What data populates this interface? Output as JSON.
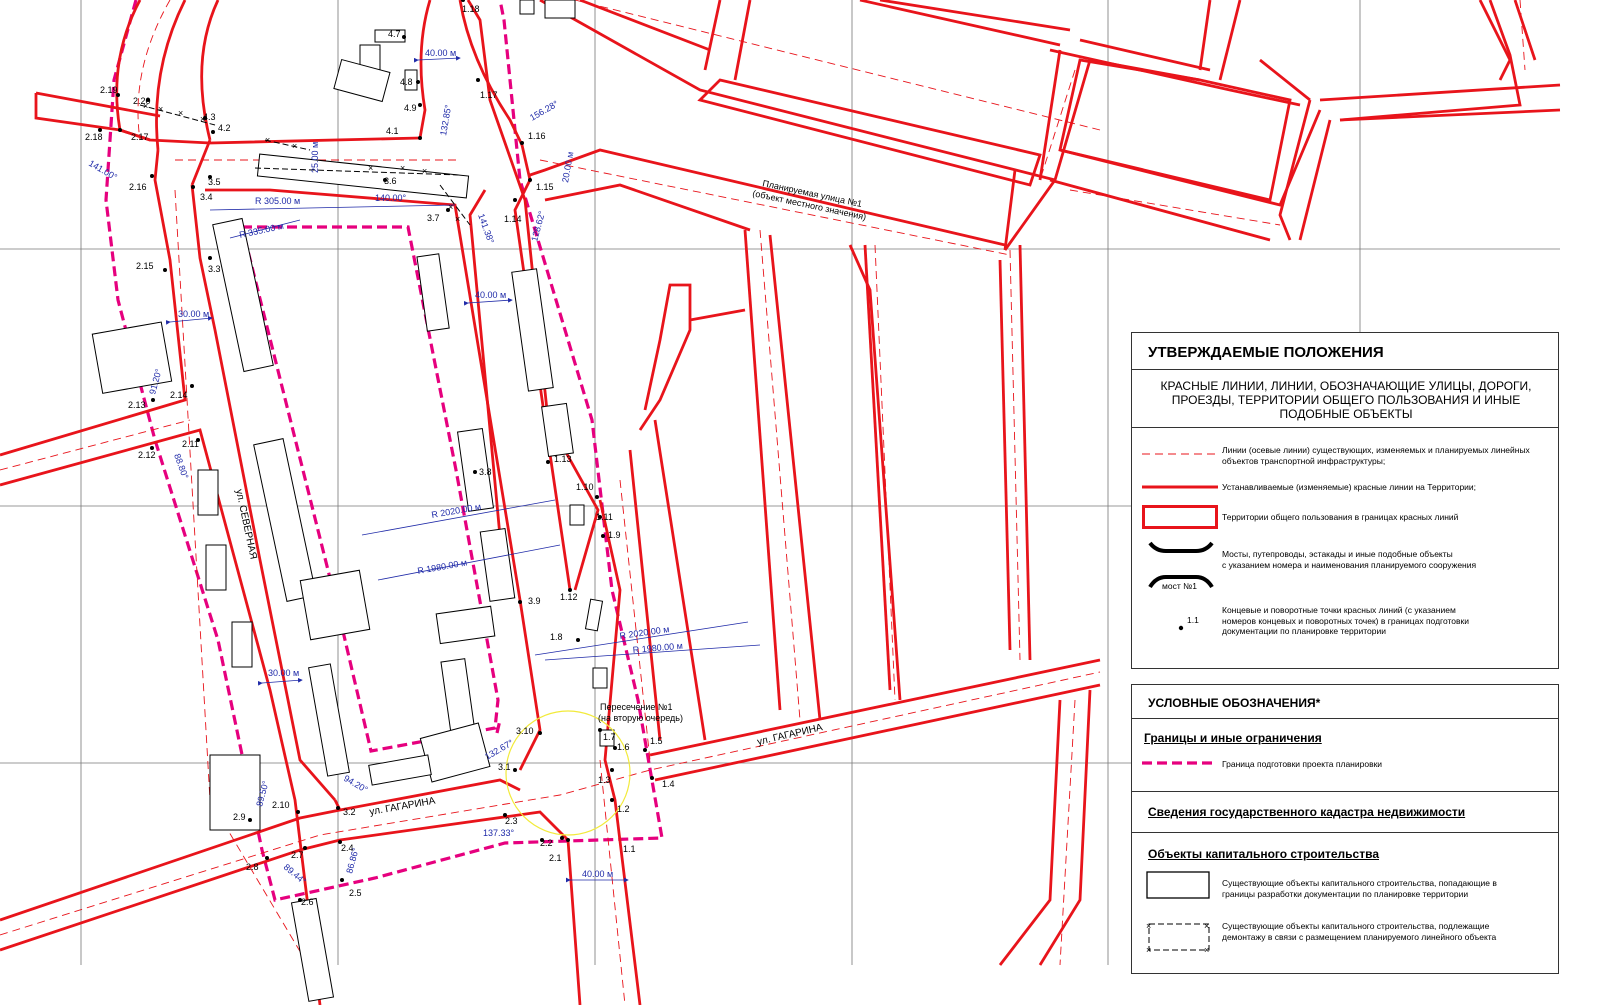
{
  "streets": {
    "severnaya": "ул. СЕВЕРНАЯ",
    "gagarina_left": "ул. ГАГАРИНА",
    "gagarina_right": "ул. ГАГАРИНА",
    "planned_1": "Планируемая улица №1",
    "planned_1_sub": "(объект местного значения)"
  },
  "intersection": {
    "label": "Пересечение №1",
    "sub": "(на вторую очередь)"
  },
  "dimensions": {
    "w40_top": "40.00 м",
    "w40_mid": "40.00 м",
    "w40_bottom": "40.00 м",
    "w30_left": "30.00 м",
    "w30_low": "30.00 м",
    "w25": "25.00 м",
    "w20": "20.00 м",
    "r305": "R 305.00 м",
    "r335": "R 335.00 м",
    "r2020_a": "R 2020.00 м",
    "r1980_a": "R 1980.00 м",
    "r2020_b": "R 2020.00 м",
    "r1980_b": "R 1980.00 м",
    "a141_00": "141.00°",
    "a132_85": "132.85°",
    "a156_28": "156.28°",
    "a140_00": "140.00°",
    "a141_38": "141.38°",
    "a128_62": "128.62°",
    "a91_20": "91.20°",
    "a88_80": "88.80°",
    "a89_50": "89.50°",
    "a94_20": "94.20°",
    "a132_67": "132.67°",
    "a137_33": "137.33°",
    "a89_44": "89.44°",
    "a86_86": "86.86°"
  },
  "points": {
    "p1_1": "1.1",
    "p1_2": "1.2",
    "p1_3": "1.3",
    "p1_4": "1.4",
    "p1_5": "1.5",
    "p1_6": "1.6",
    "p1_7": "1.7",
    "p1_8": "1.8",
    "p1_9": "1.9",
    "p1_10": "1.10",
    "p1_11": "1.11",
    "p1_12": "1.12",
    "p1_13": "1.13",
    "p1_14": "1.14",
    "p1_15": "1.15",
    "p1_16": "1.16",
    "p1_17": "1.17",
    "p1_18": "1.18",
    "p2_1": "2.1",
    "p2_2": "2.2",
    "p2_3": "2.3",
    "p2_4": "2.4",
    "p2_5": "2.5",
    "p2_6": "2.6",
    "p2_7": "2.7",
    "p2_8": "2.8",
    "p2_9": "2.9",
    "p2_10": "2.10",
    "p2_11": "2.11",
    "p2_12": "2.12",
    "p2_13": "2.13",
    "p2_14": "2.14",
    "p2_15": "2.15",
    "p2_16": "2.16",
    "p2_17": "2.17",
    "p2_18": "2.18",
    "p2_19": "2.19",
    "p2_20": "2.20",
    "p3_1": "3.1",
    "p3_2": "3.2",
    "p3_3": "3.3",
    "p3_4": "3.4",
    "p3_5": "3.5",
    "p3_6": "3.6",
    "p3_7": "3.7",
    "p3_8": "3.8",
    "p3_9": "3.9",
    "p3_10": "3.10",
    "p4_1": "4.1",
    "p4_2": "4.2",
    "p4_3": "4.3",
    "p4_7": "4.7",
    "p4_8": "4.8",
    "p4_9": "4.9"
  },
  "legend_main": {
    "title": "УТВЕРЖДАЕМЫЕ ПОЛОЖЕНИЯ",
    "subtitle_l1": "КРАСНЫЕ ЛИНИИ, ЛИНИИ, ОБОЗНАЧАЮЩИЕ УЛИЦЫ, ДОРОГИ,",
    "subtitle_l2": "ПРОЕЗДЫ, ТЕРРИТОРИИ ОБЩЕГО ПОЛЬЗОВАНИЯ И ИНЫЕ",
    "subtitle_l3": "ПОДОБНЫЕ ОБЪЕКТЫ",
    "item1_l1": "Линии (осевые линии) существующих, изменяемых и планируемых линейных",
    "item1_l2": "объектов транспортной инфраструктуры;",
    "item2": "Устанавливаемые (изменяемые) красные линии на Территории;",
    "item3": "Территории общего пользования в границах красных линий",
    "item4_l1": "Мосты, путепроводы, эстакады и иные подобные объекты",
    "item4_l2": "с указанием номера и наименования планируемого сооружения",
    "item4_bridge": "мост №1",
    "item5_l1": "Концевые и поворотные точки красных линий (с указанием",
    "item5_l2": "номеров концевых и поворотных точек) в границах подготовки",
    "item5_l3": "документации по планировке территории",
    "item5_point": "1.1"
  },
  "legend_conv": {
    "title": "УСЛОВНЫЕ ОБОЗНАЧЕНИЯ*",
    "section1": "Границы и иные ограничения",
    "item_boundary": "Граница подготовки проекта планировки",
    "section2": "Сведения государственного кадастра недвижимости",
    "section3": "Объекты капитального строительства",
    "item_existing_l1": "Существующие объекты капитального строительства, попадающие в",
    "item_existing_l2": "границы разработки документации по планировке территории",
    "item_demolish_l1": "Существующие объекты капитального строительства, подлежащие",
    "item_demolish_l2": "демонтажу в связи с размещением планируемого линейного объекта"
  },
  "colors": {
    "red_line": "#e8141b",
    "boundary": "#e6007e",
    "dimension": "#1f2aa8",
    "grid": "#777777",
    "circle": "#f2ea3a"
  }
}
